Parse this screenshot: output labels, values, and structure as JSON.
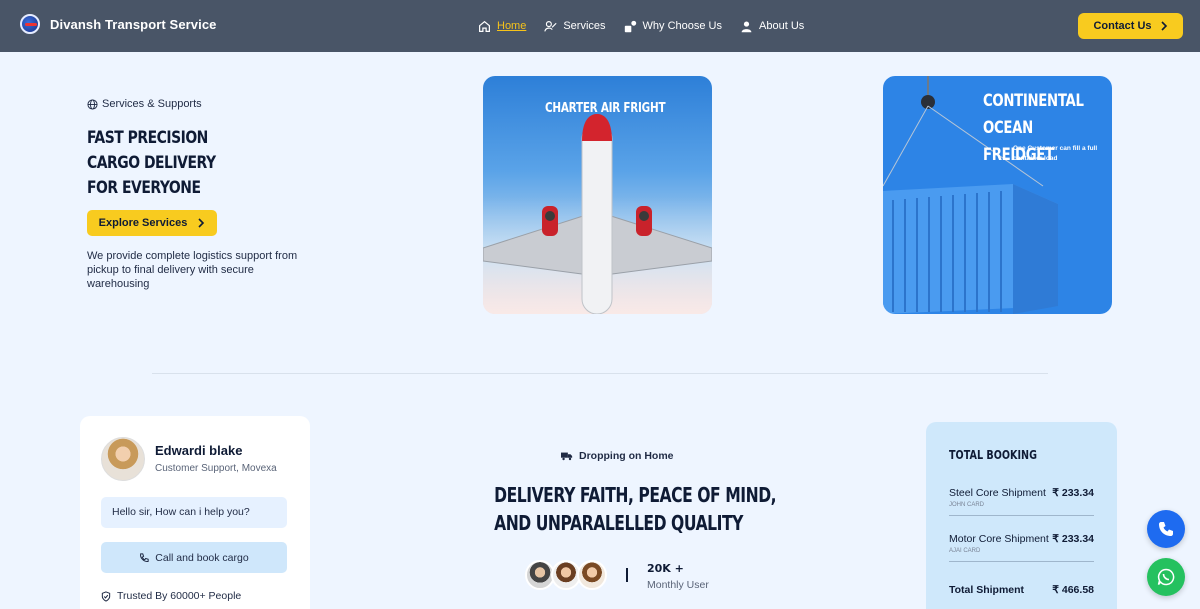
{
  "brand": {
    "name": "Divansh Transport Service"
  },
  "nav": {
    "items": [
      {
        "label": "Home",
        "icon": "home-icon"
      },
      {
        "label": "Services",
        "icon": "services-icon"
      },
      {
        "label": "Why Choose Us",
        "icon": "why-icon"
      },
      {
        "label": "About Us",
        "icon": "user-icon"
      }
    ],
    "contact_label": "Contact Us"
  },
  "hero": {
    "eyebrow": "Services & Supports",
    "title_lines": [
      "FAST PRECISION",
      "CARGO DELIVERY",
      "FOR EVERYONE"
    ],
    "button": "Explore Services",
    "description": "We provide complete logistics support from pickup to final delivery with secure warehousing"
  },
  "cards": {
    "plane_caption": "CHARTER AIR FRIGHT",
    "ocean_caption_lines": [
      "CONTINENTAL",
      "OCEAN FREIDGET"
    ],
    "ocean_sub": "One Customer can fill a full container load"
  },
  "chat": {
    "name": "Edwardi blake",
    "role": "Customer Support, Movexa",
    "message": "Hello sir, How can i help you?",
    "call_label": "Call and book cargo",
    "trusted": "Trusted By 60000+ People"
  },
  "center": {
    "drop_label": "Dropping on Home",
    "tagline_lines": [
      "DELIVERY FAITH, PEACE OF MIND,",
      "AND UNPARALELLED QUALITY"
    ],
    "stat_value": "20K +",
    "stat_label": "Monthly User"
  },
  "booking": {
    "title": "TOTAL BOOKING",
    "rows": [
      {
        "name": "Steel Core Shipment",
        "amount": "₹ 233.34",
        "card": "JOHN CARD"
      },
      {
        "name": "Motor Core Shipment",
        "amount": "₹ 233.34",
        "card": "AJAI CARD"
      }
    ],
    "total": {
      "name": "Total Shipment",
      "amount": "₹ 466.58"
    }
  },
  "colors": {
    "nav_bg": "#495567",
    "accent": "#f8cb1f",
    "page_bg": "#eef5ff",
    "phone": "#1e6bf0",
    "whatsapp": "#25c15f"
  }
}
